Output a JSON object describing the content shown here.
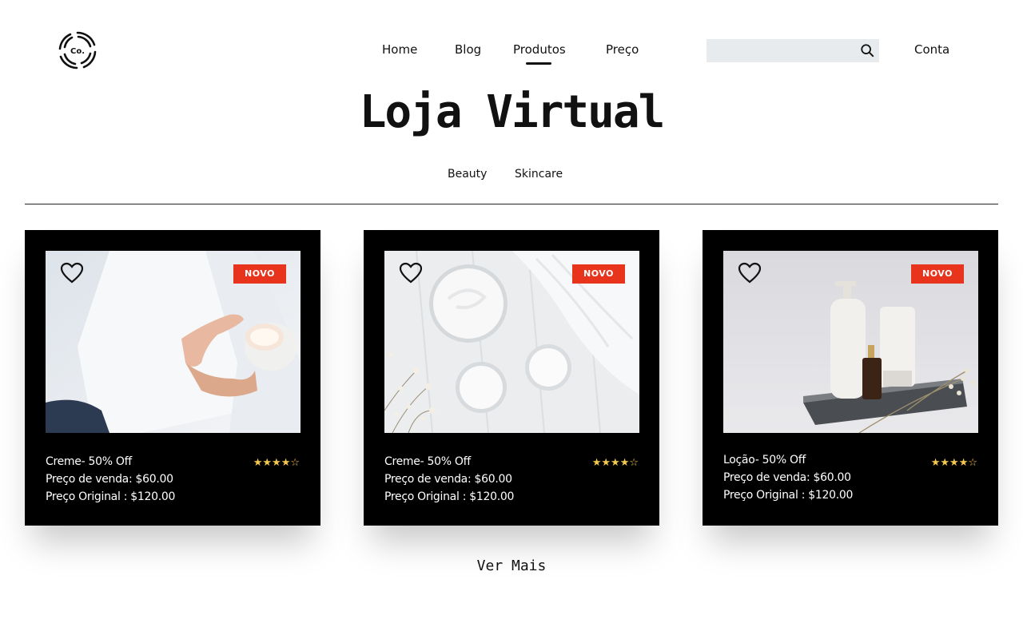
{
  "header": {
    "logo_text": "Co.",
    "nav": [
      {
        "label": "Home"
      },
      {
        "label": "Blog"
      },
      {
        "label": "Produtos"
      },
      {
        "label": "Preço"
      }
    ],
    "search": {
      "value": "",
      "placeholder": ""
    },
    "account_label": "Conta"
  },
  "page": {
    "title": "Loja Virtual",
    "categories": [
      {
        "label": "Beauty"
      },
      {
        "label": "Skincare"
      }
    ],
    "more_label": "Ver Mais"
  },
  "products": [
    {
      "badge": "NOVO",
      "name": "Creme- 50% Off",
      "sale_price": "Preço de venda: $60.00",
      "original_price": "Preço Original : $120.00",
      "rating": 4,
      "rating_max": 5
    },
    {
      "badge": "NOVO",
      "name": "Creme- 50% Off",
      "sale_price": "Preço de venda: $60.00",
      "original_price": "Preço Original : $120.00",
      "rating": 4,
      "rating_max": 5
    },
    {
      "badge": "NOVO",
      "name": "Loção- 50% Off",
      "sale_price": "Preço de venda: $60.00",
      "original_price": "Preço Original : $120.00",
      "rating": 4,
      "rating_max": 5
    }
  ],
  "colors": {
    "badge": "#e8341c",
    "star": "#f4c84a",
    "card": "#000000",
    "search_bg": "#e8ebee"
  },
  "icons": {
    "logo": "swirl-logo-icon",
    "search": "search-icon",
    "favorite": "heart-icon",
    "rating": "star-icon"
  }
}
